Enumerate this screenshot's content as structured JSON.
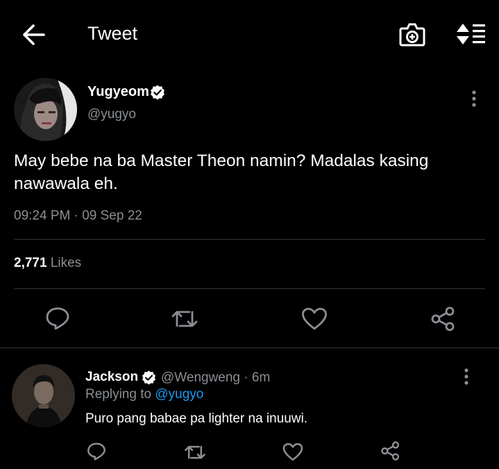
{
  "header": {
    "title": "Tweet"
  },
  "tweet": {
    "author_name": "Yugyeom",
    "author_handle": "@yugyo",
    "text": "May bebe na ba Master Theon namin? Madalas kasing nawawala eh.",
    "timestamp": "09:24 PM · 09 Sep 22",
    "likes_count": "2,771",
    "likes_label": "Likes"
  },
  "reply": {
    "author_name": "Jackson",
    "author_handle": "@Wengweng",
    "time": "6m",
    "replying_label": "Replying to",
    "replying_mention": "@yugyo",
    "text": "Puro pang babae pa lighter na inuuwi."
  },
  "colors": {
    "background": "#000000",
    "secondary_text": "#8b8f94",
    "link": "#1d9bf0",
    "divider": "#2f3336"
  },
  "icons": [
    "back-arrow-icon",
    "camera-plus-icon",
    "sort-list-icon",
    "verified-badge-icon",
    "more-vertical-icon",
    "reply-icon",
    "retweet-icon",
    "like-icon",
    "share-icon"
  ]
}
